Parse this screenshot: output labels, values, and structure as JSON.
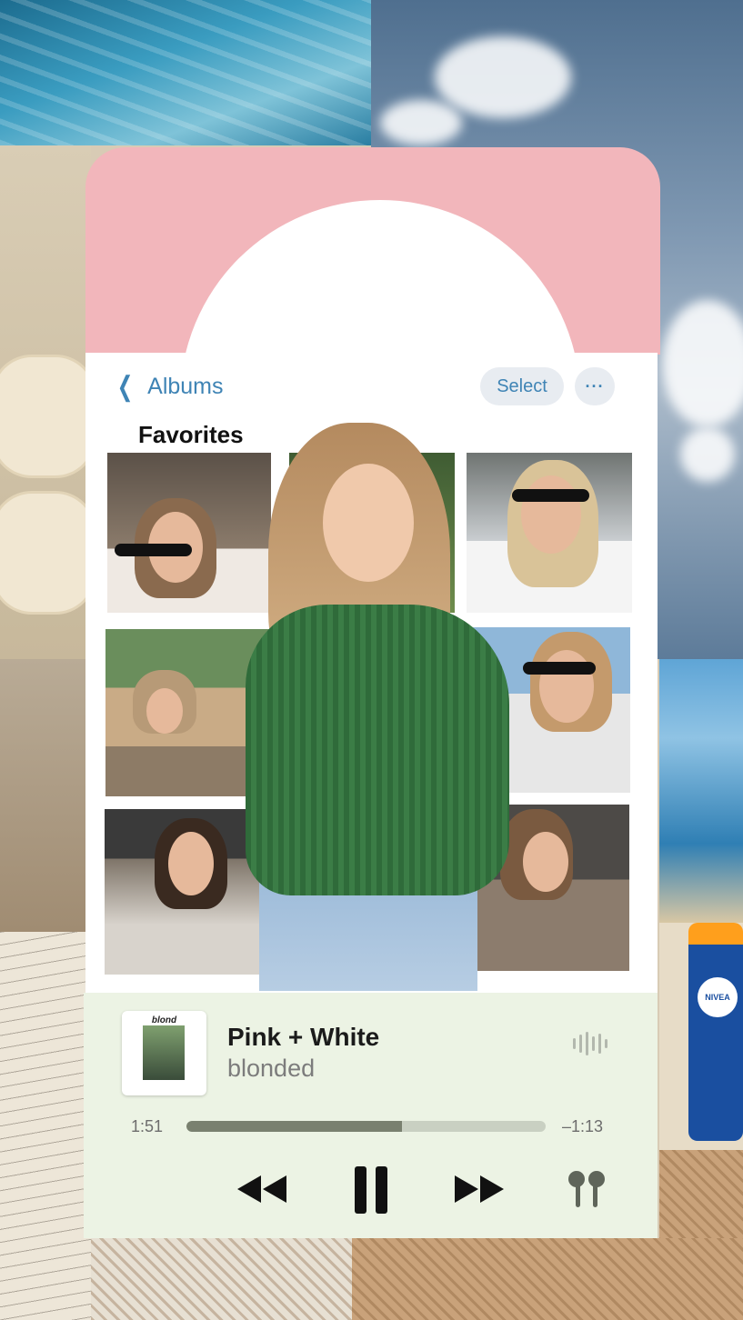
{
  "nav": {
    "back_label": "Albums",
    "select_label": "Select",
    "more_label": "···"
  },
  "album": {
    "title": "Favorites"
  },
  "now_playing": {
    "cover_word": "blond",
    "song": "Pink + White",
    "artist": "blonded",
    "elapsed": "1:51",
    "remaining": "–1:13",
    "progress": 0.6
  },
  "colors": {
    "accent": "#3f84b5",
    "phone_top": "#f2b6bb",
    "player_bg": "#ecf3e4",
    "progress_fill": "#79806f"
  },
  "icons": [
    "chevron-left-icon",
    "more-icon",
    "waveform-icon",
    "rewind-icon",
    "pause-icon",
    "fast-forward-icon",
    "airpods-icon"
  ]
}
